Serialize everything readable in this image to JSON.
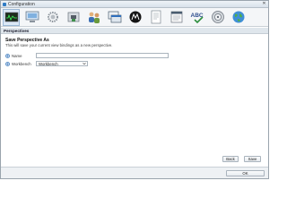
{
  "window": {
    "title": "Configuration",
    "close_glyph": "✕"
  },
  "toolbar": {
    "icons": [
      "system-monitor-icon",
      "computer-icon",
      "gears-icon",
      "ethernet-icon",
      "users-icon",
      "windows-icon",
      "m-logo-icon",
      "document-icon",
      "notes-icon",
      "spellcheck-icon",
      "badge-icon",
      "globe-icon"
    ],
    "active_index": 0
  },
  "section": {
    "title": "Perspectives"
  },
  "form": {
    "title": "Save Perspective As",
    "description": "This will save your current view bindings as a new perspective.",
    "name_label": "Name",
    "name_value": "",
    "workbench_label": "Workbench",
    "workbench_value": "Workbench"
  },
  "buttons": {
    "back": "Back",
    "save": "Save",
    "ok": "OK"
  },
  "colors": {
    "accent": "#2f6fbd",
    "header_bg": "#dfe6ec"
  }
}
